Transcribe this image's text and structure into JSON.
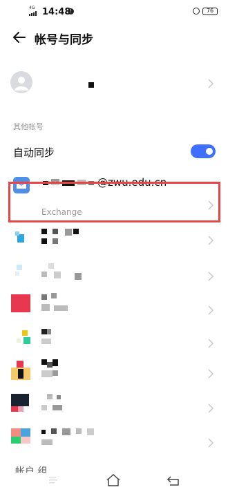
{
  "status_bar": {
    "network": "4G",
    "time": "14:48",
    "battery": "76"
  },
  "header": {
    "title": "帐号与同步"
  },
  "sections": {
    "other_accounts_label": "其他帐号",
    "auto_sync_label": "自动同步",
    "auto_sync_on": true
  },
  "exchange_account": {
    "email": "@zwu.edu.cn",
    "type": "Exchange"
  },
  "bottom_label": "帐户 组",
  "colors": {
    "accent": "#3f6fff",
    "highlight": "#e64545",
    "exchange_icon": "#4f8fe6"
  }
}
